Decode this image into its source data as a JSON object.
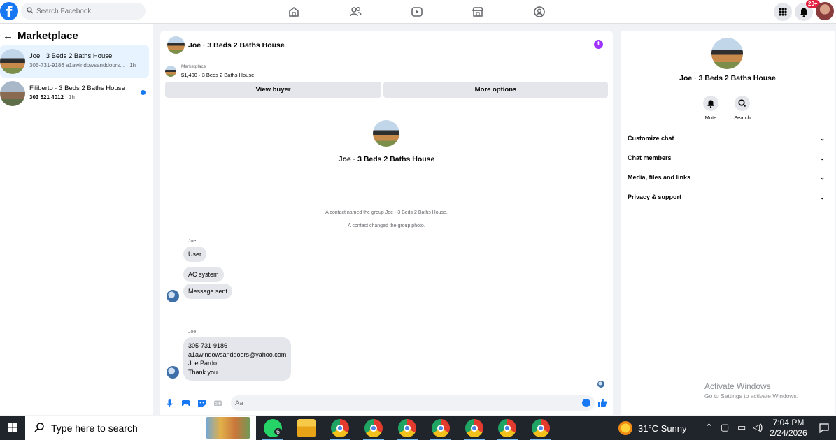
{
  "topbar": {
    "search_placeholder": "Search Facebook",
    "notification_count": "20+",
    "nav_icons": [
      "home-icon",
      "friends-icon",
      "watch-icon",
      "marketplace-icon",
      "groups-icon"
    ]
  },
  "sidebar": {
    "title": "Marketplace",
    "conversations": [
      {
        "name": "Joe · 3 Beds 2 Baths House",
        "preview": "305-731-9186 a1awindowsanddoors...",
        "time": "· 1h",
        "active": true,
        "unread": false
      },
      {
        "name": "Filiberto · 3 Beds 2 Baths House",
        "preview": "303 521 4012",
        "time": "· 1h",
        "active": false,
        "unread": true
      }
    ]
  },
  "chat": {
    "title": "Joe · 3 Beds 2 Baths House",
    "listing_label": "Marketplace",
    "listing_summary": "$1,400 · 3 Beds 2 Baths House",
    "view_buyer": "View buyer",
    "more_options": "More options",
    "intro_title": "Joe · 3 Beds 2 Baths House",
    "system_messages": [
      "A contact named the group Joe · 3 Beds 2 Baths House.",
      "A contact changed the group photo."
    ],
    "groups": [
      {
        "sender": "Joe",
        "bubbles": [
          "User",
          "AC system",
          "Message sent"
        ]
      },
      {
        "sender": "Joe",
        "lines": [
          "305-731-9186",
          "a1awindowsanddoors@yahoo.com",
          "Joe Pardo",
          "Thank you"
        ]
      }
    ],
    "input_placeholder": "Aa"
  },
  "right_panel": {
    "title": "Joe · 3 Beds 2 Baths House",
    "mute_label": "Mute",
    "search_label": "Search",
    "sections": [
      "Customize chat",
      "Chat members",
      "Media, files and links",
      "Privacy & support"
    ]
  },
  "watermark": {
    "line1": "Activate Windows",
    "line2": "Go to Settings to activate Windows."
  },
  "taskbar": {
    "search_placeholder": "Type here to search",
    "whatsapp_badge": "6",
    "weather": "31°C  Sunny",
    "time": "7:04 PM",
    "date": "2/24/2026"
  },
  "colors": {
    "brand": "#1877f2",
    "active_conversation": "#e7f3ff",
    "info_icon": "#a033ff",
    "notification_badge": "#e41e3f"
  }
}
